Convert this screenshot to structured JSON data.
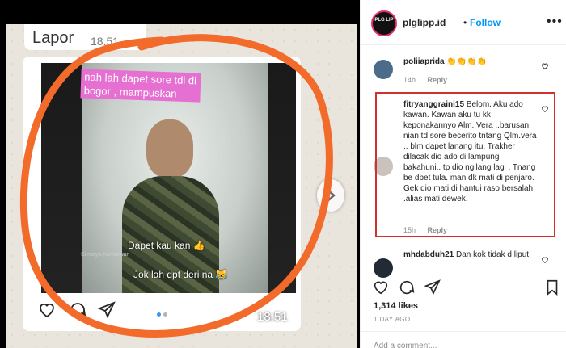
{
  "media": {
    "wa_title": "Lapor",
    "wa_time_top": "18.51",
    "wa_time_bottom": "18.51",
    "overlay_text": "nah lah dapet sore tdi di bogor , mampuskan",
    "caption_1": "Dapet kau kan 👍",
    "caption_2": "Jok lah dpt deri na 😹",
    "sub_caption": "Si maya Kurniawan"
  },
  "post": {
    "avatar_text": "PLG LIP",
    "username": "plglipp.id",
    "follow_separator": "•",
    "follow_label": "Follow",
    "more_icon": "•••",
    "likes": "1,314 likes",
    "time_ago": "1 DAY AGO",
    "add_comment_placeholder": "Add a comment..."
  },
  "comments": [
    {
      "username": "poliiaprida",
      "text": "👏👏👏👏",
      "age": "14h",
      "reply": "Reply",
      "avatar_color": "#4a6b8a"
    },
    {
      "username": "fitryanggraini15",
      "text": "Belom. Aku ado kawan. Kawan aku tu kk keponakannyo Alm. Vera ..barusan nian td sore becerito tntang Qlm.vera .. blm dapet lanang itu. Trakher dilacak dio ado di lampung bakahuni.. tp dio ngilang lagi . Tnang be dpet tula. man dk mati di penjaro. Gek dio mati di hantui raso bersalah .alias mati dewek.",
      "age": "15h",
      "reply": "Reply",
      "avatar_color": "#c9c2bd"
    },
    {
      "username": "mhdabduh21",
      "text": "Dan kok tidak d liput",
      "age": "",
      "reply": "",
      "avatar_color": "#222a35"
    }
  ],
  "colors": {
    "accent": "#0095f6",
    "ring": "#f26b2a",
    "highlight_box": "#d0312d",
    "overlay": "#e66fd2"
  }
}
